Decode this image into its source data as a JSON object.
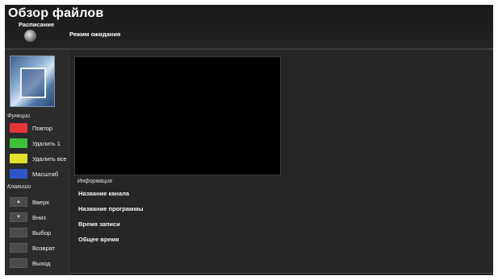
{
  "header": {
    "title": "Обзор файлов",
    "schedule_label": "Расписание",
    "mode_label": "Режим ожидания"
  },
  "functions": {
    "heading": "Функции",
    "items": [
      {
        "label": "Повтор",
        "color": "#e8353a"
      },
      {
        "label": "Удалить 1",
        "color": "#3fbf3a"
      },
      {
        "label": "Удалить все",
        "color": "#e2df2d"
      },
      {
        "label": "Масштаб",
        "color": "#2f56c9"
      }
    ]
  },
  "keys": {
    "heading": "Клавиши",
    "items": [
      {
        "label": "Вверх",
        "icon": "up-arrow-icon"
      },
      {
        "label": "Вниз",
        "icon": "down-arrow-icon"
      },
      {
        "label": "Выбор",
        "icon": "ok-icon"
      },
      {
        "label": "Возврат",
        "icon": "return-icon"
      },
      {
        "label": "Выход",
        "icon": "exit-icon"
      }
    ]
  },
  "info": {
    "heading": "Информация",
    "fields": [
      "Название канала",
      "Название программы",
      "Время записи",
      "Общее время"
    ]
  }
}
